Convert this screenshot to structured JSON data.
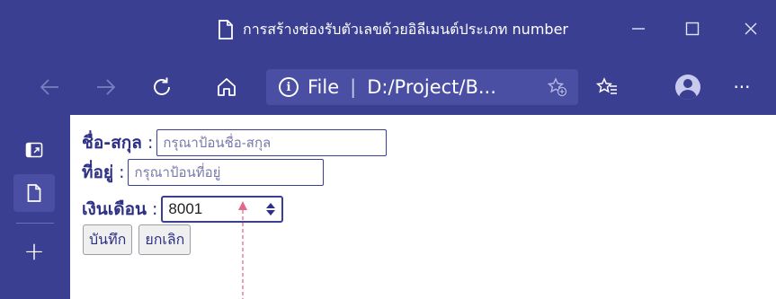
{
  "window": {
    "title": "การสร้างช่องรับตัวเลขด้วยอิลีเมนต์ประเภท number"
  },
  "toolbar": {
    "address_info_glyph": "i",
    "address_scheme": "File",
    "address_separator": "|",
    "address_path": "D:/Project/B...",
    "more_label": "···"
  },
  "sidebar": {
    "new_tab_label": "+"
  },
  "form": {
    "name": {
      "label": "ชื่อ-สกุล",
      "colon": ":",
      "placeholder": "กรุณาป้อนชื่อ-สกุล"
    },
    "address": {
      "label": "ที่อยู่",
      "colon": ":",
      "placeholder": "กรุณาป้อนที่อยู่"
    },
    "salary": {
      "label": "เงินเดือน",
      "colon": ":",
      "value": "8001"
    },
    "save_label": "บันทึก",
    "cancel_label": "ยกเลิก"
  },
  "colors": {
    "chrome_bg": "#3b3f91",
    "address_bg": "#4a4fa3",
    "label_text": "#2e3085",
    "annotation_arrow": "#e06a8c"
  },
  "icons": [
    "document-icon",
    "minimize-icon",
    "maximize-icon",
    "close-icon",
    "back-arrow-icon",
    "forward-arrow-icon",
    "refresh-icon",
    "home-icon",
    "info-icon",
    "add-favorite-icon",
    "favorites-icon",
    "profile-icon",
    "more-icon",
    "tab-actions-icon",
    "page-icon",
    "plus-icon",
    "spinner-icon",
    "annotation-arrow-icon"
  ]
}
